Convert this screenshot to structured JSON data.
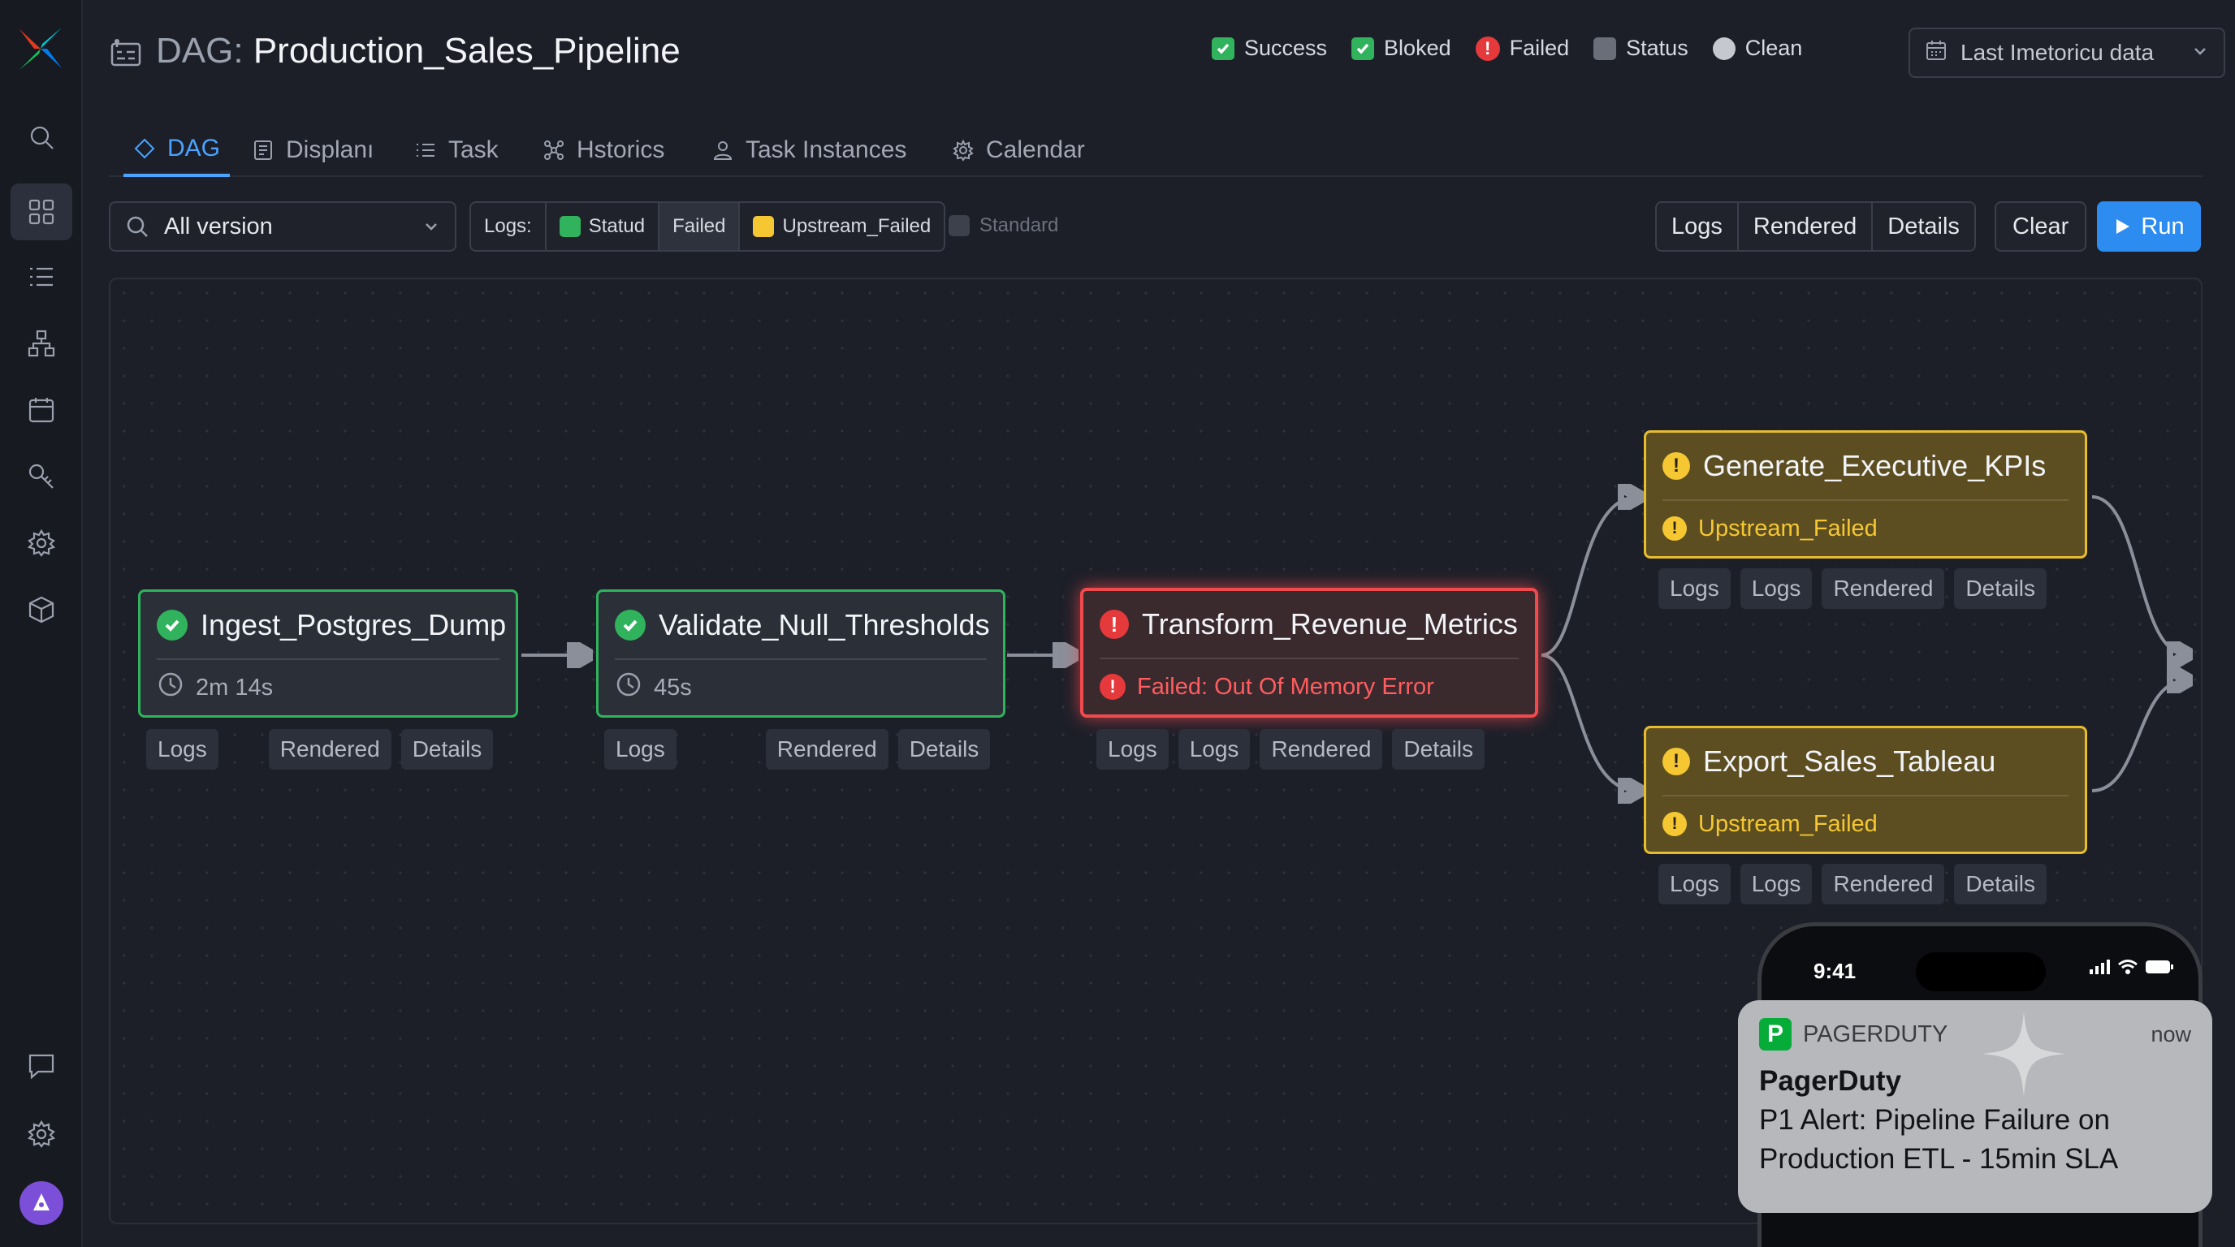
{
  "window": {
    "title_prefix": "DAG:",
    "title": "Production_Sales_Pipeline"
  },
  "legend": {
    "items": [
      {
        "label": "Success",
        "color": "#31b35d"
      },
      {
        "label": "Bloked",
        "color": "#31b35d"
      },
      {
        "label": "Failed",
        "color": "#e5393b"
      },
      {
        "label": "Status",
        "color": "#6a6e78"
      },
      {
        "label": "Clean",
        "color": "#c5c8cf"
      }
    ]
  },
  "date_select": {
    "value": "Last Imetoricu data"
  },
  "tabs": [
    {
      "label": "DAG",
      "icon": "diamond-icon",
      "active": true
    },
    {
      "label": "Displanı",
      "icon": "document-icon"
    },
    {
      "label": "Task",
      "icon": "list-icon"
    },
    {
      "label": "Hstorics",
      "icon": "graph-icon"
    },
    {
      "label": "Task Instances",
      "icon": "user-icon"
    },
    {
      "label": "Calendar",
      "icon": "gear-icon"
    }
  ],
  "toolbar": {
    "version_value": "All version",
    "logs_label": "Logs:",
    "filter_statud": "Statud",
    "filter_failed": "Failed",
    "filter_upstream": "Upstream_Failed",
    "filter_standard": "Standard",
    "logs_btn": "Logs",
    "rendered_btn": "Rendered",
    "details_btn": "Details",
    "clear_btn": "Clear",
    "run_btn": "Run"
  },
  "nodes": [
    {
      "name": "Ingest_Postgres_Dump",
      "status": "success",
      "sub": "2m 14s",
      "buttons": [
        "Logs",
        "Rendered",
        "Details"
      ]
    },
    {
      "name": "Validate_Null_Thresholds",
      "status": "success",
      "sub": "45s",
      "buttons": [
        "Logs",
        "Rendered",
        "Details"
      ]
    },
    {
      "name": "Transform_Revenue_Metrics",
      "status": "failed",
      "sub": "Failed: Out Of Memory Error",
      "buttons": [
        "Logs",
        "Logs",
        "Rendered",
        "Details"
      ]
    },
    {
      "name": "Generate_Executive_KPIs",
      "status": "upstream_failed",
      "sub": "Upstream_Failed",
      "buttons": [
        "Logs",
        "Logs",
        "Rendered",
        "Details"
      ]
    },
    {
      "name": "Export_Sales_Tableau",
      "status": "upstream_failed",
      "sub": "Upstream_Failed",
      "buttons": [
        "Logs",
        "Logs",
        "Rendered",
        "Details"
      ]
    }
  ],
  "phone": {
    "time": "9:41"
  },
  "notification": {
    "app": "PAGERDUTY",
    "app_letter": "P",
    "when": "now",
    "title": "PagerDuty",
    "body": "P1 Alert: Pipeline Failure on Production ETL - 15min SLA"
  }
}
